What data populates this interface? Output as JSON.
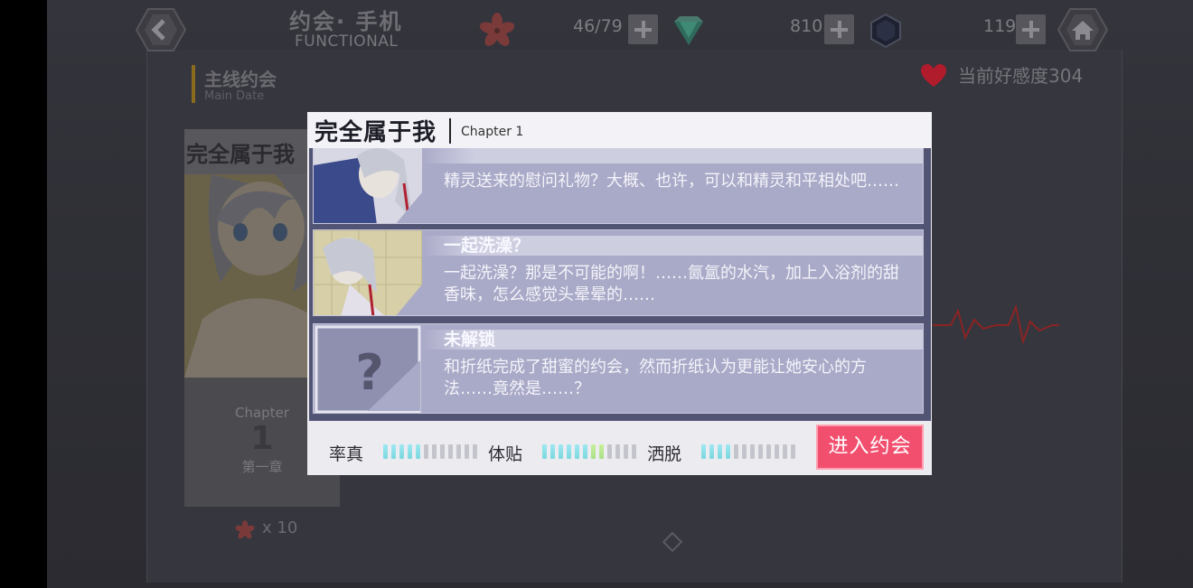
{
  "topbar": {
    "title": "约会· 手机",
    "subtitle": "FUNCTIONAL",
    "resources": [
      {
        "icon": "sakura-icon",
        "value": "46/79"
      },
      {
        "icon": "green-crystal-icon",
        "value": "810"
      },
      {
        "icon": "dark-crystal-icon",
        "value": "119"
      }
    ]
  },
  "section": {
    "title": "主线约会",
    "subtitle": "Main Date"
  },
  "card": {
    "title": "完全属于我",
    "chapter_en": "Chapter",
    "chapter_num": "1",
    "chapter_cn": "第一章",
    "cost": "x 10"
  },
  "affinity": {
    "label": "当前好感度304"
  },
  "modal": {
    "title": "完全属于我",
    "chapter": "Chapter 1",
    "items": [
      {
        "name": "",
        "desc": "精灵送来的慰问礼物？大概、也许，可以和精灵和平相处吧……"
      },
      {
        "name": "一起洗澡？",
        "desc": "一起洗澡？那是不可能的啊！……氤氲的水汽，加上入浴剂的甜香味，怎么感觉头晕晕的……"
      },
      {
        "name": "未解锁",
        "desc": "和折纸完成了甜蜜的约会，然而折纸认为更能让她安心的方法……竟然是……？"
      }
    ],
    "stats": [
      {
        "label": "率真",
        "level": 5,
        "max": 12
      },
      {
        "label": "体贴",
        "level": 8,
        "max": 12
      },
      {
        "label": "洒脱",
        "level": 4,
        "max": 12
      }
    ],
    "enter_label": "进入约会"
  },
  "colors": {
    "accent": "#f24f6f",
    "list_bg": "#525474",
    "item_bg": "#a9a9c8"
  }
}
